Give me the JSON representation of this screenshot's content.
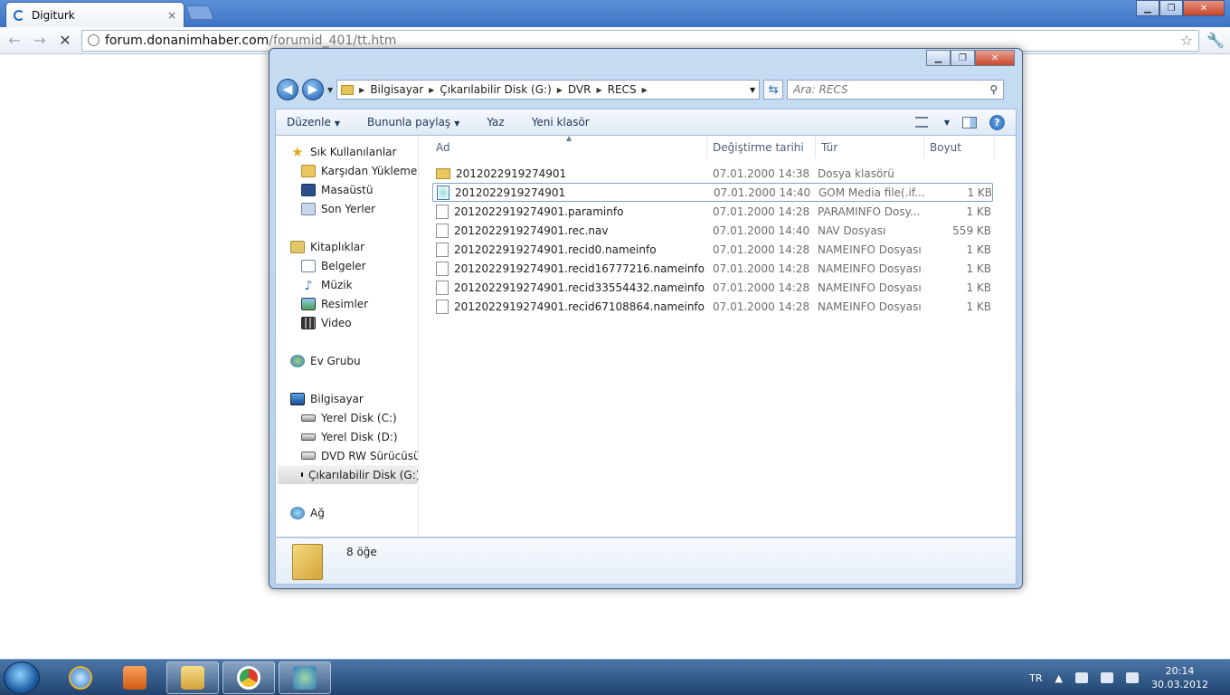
{
  "browser": {
    "tab_title": "Digiturk",
    "tab_close": "×",
    "url_host": "forum.donanimhaber.com",
    "url_path": "/forumid_401/tt.htm"
  },
  "explorer": {
    "breadcrumbs": [
      "Bilgisayar",
      "Çıkarılabilir Disk (G:)",
      "DVR",
      "RECS"
    ],
    "search_placeholder": "Ara: RECS",
    "toolbar": {
      "organize": "Düzenle",
      "share": "Bununla paylaş",
      "burn": "Yaz",
      "new_folder": "Yeni klasör"
    },
    "nav": {
      "favorites": "Sık Kullanılanlar",
      "downloads": "Karşıdan Yüklemeler",
      "desktop": "Masaüstü",
      "recent": "Son Yerler",
      "libraries": "Kitaplıklar",
      "documents": "Belgeler",
      "music": "Müzik",
      "pictures": "Resimler",
      "video": "Video",
      "homegroup": "Ev Grubu",
      "computer": "Bilgisayar",
      "disk_c": "Yerel Disk (C:)",
      "disk_d": "Yerel Disk (D:)",
      "dvd": "DVD RW Sürücüsü (F",
      "usb_g": "Çıkarılabilir Disk (G:)",
      "network": "Ağ"
    },
    "columns": {
      "name": "Ad",
      "date": "Değiştirme tarihi",
      "type": "Tür",
      "size": "Boyut"
    },
    "files": [
      {
        "name": "2012022919274901",
        "date": "07.01.2000 14:38",
        "type": "Dosya klasörü",
        "size": "",
        "icon": "folder-icon"
      },
      {
        "name": "2012022919274901",
        "date": "07.01.2000 14:40",
        "type": "GOM Media file(.if...",
        "size": "1 KB",
        "icon": "gom-file-icon"
      },
      {
        "name": "2012022919274901.paraminfo",
        "date": "07.01.2000 14:28",
        "type": "PARAMINFO Dosy...",
        "size": "1 KB",
        "icon": "file-icon"
      },
      {
        "name": "2012022919274901.rec.nav",
        "date": "07.01.2000 14:40",
        "type": "NAV Dosyası",
        "size": "559 KB",
        "icon": "file-icon"
      },
      {
        "name": "2012022919274901.recid0.nameinfo",
        "date": "07.01.2000 14:28",
        "type": "NAMEINFO Dosyası",
        "size": "1 KB",
        "icon": "file-icon"
      },
      {
        "name": "2012022919274901.recid16777216.nameinfo",
        "date": "07.01.2000 14:28",
        "type": "NAMEINFO Dosyası",
        "size": "1 KB",
        "icon": "file-icon"
      },
      {
        "name": "2012022919274901.recid33554432.nameinfo",
        "date": "07.01.2000 14:28",
        "type": "NAMEINFO Dosyası",
        "size": "1 KB",
        "icon": "file-icon"
      },
      {
        "name": "2012022919274901.recid67108864.nameinfo",
        "date": "07.01.2000 14:28",
        "type": "NAMEINFO Dosyası",
        "size": "1 KB",
        "icon": "file-icon"
      }
    ],
    "status": "8 öğe"
  },
  "taskbar": {
    "lang": "TR",
    "time": "20:14",
    "date": "30.03.2012"
  }
}
